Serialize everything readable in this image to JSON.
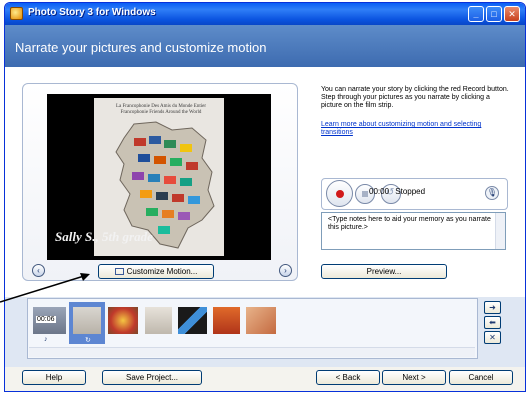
{
  "window": {
    "title": "Photo Story 3 for Windows",
    "controls": {
      "minimize": "_",
      "maximize": "□",
      "close": "✕"
    }
  },
  "header": {
    "title": "Narrate your pictures and customize motion"
  },
  "preview": {
    "poster_text": "La Francophonie Des Amis du Monde Entier Francophonie Friends Around the World",
    "caption": "Sally S.,  5th grade",
    "prev_icon": "chevron-left-icon",
    "next_icon": "chevron-right-icon",
    "customize_button": "Customize Motion..."
  },
  "info": {
    "description": "You can narrate your story by clicking the red Record button. Step through your pictures as you narrate by clicking a picture on the film strip.",
    "link": "Learn more about customizing motion and selecting transitions"
  },
  "recorder": {
    "time": "00:00",
    "state": "Stopped",
    "record_icon": "record-icon",
    "stop_icon": "stop-icon",
    "undo_icon": "undo-icon",
    "mic_icon": "microphone-icon"
  },
  "notes": {
    "text": "<Type notes here to aid your memory as you narrate this picture.>"
  },
  "preview_button": "Preview...",
  "filmstrip": {
    "duration_label": "00:06",
    "thumbnails": [
      {
        "name": "thumb-1-narrated"
      },
      {
        "name": "thumb-2-selected"
      },
      {
        "name": "thumb-3"
      },
      {
        "name": "thumb-4"
      },
      {
        "name": "thumb-5"
      },
      {
        "name": "thumb-6"
      },
      {
        "name": "thumb-7"
      }
    ],
    "side_buttons": [
      "➜",
      "⬅",
      "✕"
    ]
  },
  "footer": {
    "help": "Help",
    "save": "Save Project...",
    "back": "< Back",
    "next": "Next >",
    "cancel": "Cancel"
  }
}
